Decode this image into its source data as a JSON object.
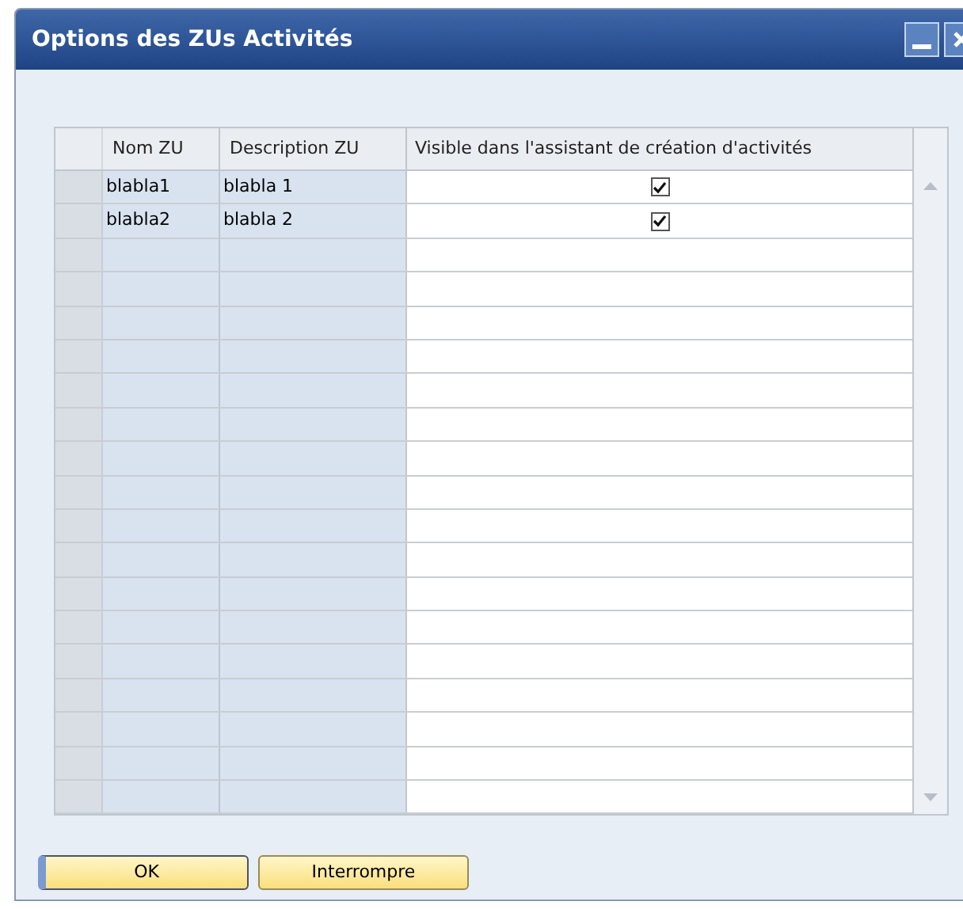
{
  "window": {
    "title": "Options des ZUs Activités"
  },
  "table": {
    "columns": [
      "Nom ZU",
      "Description ZU",
      "Visible dans l'assistant de création d'activités"
    ],
    "rows": [
      {
        "name": "blabla1",
        "description": "blabla 1",
        "checked": true
      },
      {
        "name": "blabla2",
        "description": "blabla 2",
        "checked": true
      }
    ]
  },
  "buttons": [
    {
      "label": "OK",
      "selected": true
    },
    {
      "label": "Interrompre",
      "selected": false
    }
  ]
}
